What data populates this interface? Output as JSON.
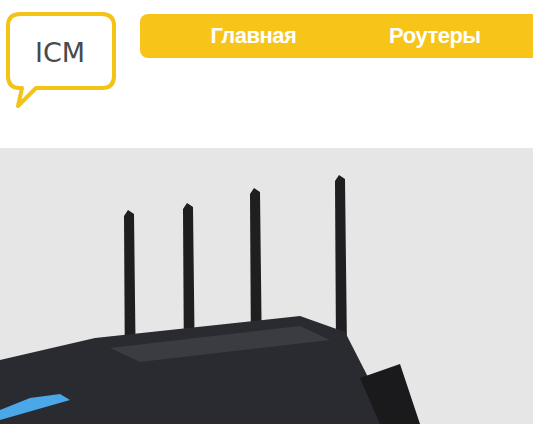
{
  "logo": {
    "text": "ICM"
  },
  "nav": {
    "items": [
      {
        "label": "Главная"
      },
      {
        "label": "Роутеры"
      }
    ]
  }
}
